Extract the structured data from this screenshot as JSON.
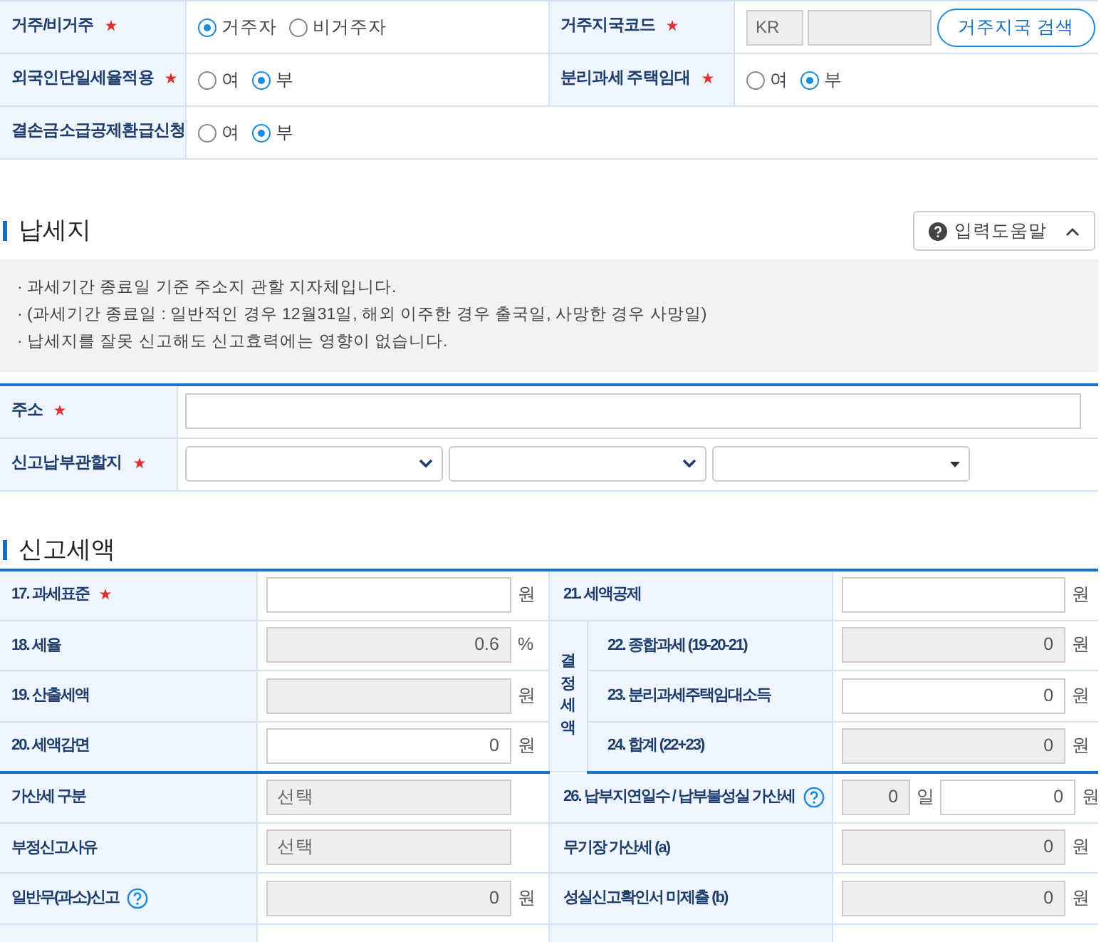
{
  "top_form": [
    {
      "label": "거주/비거주",
      "required": true,
      "kind": "radio",
      "options": [
        {
          "label": "거주자",
          "selected": true
        },
        {
          "label": "비거주자",
          "selected": false
        }
      ]
    },
    {
      "label": "거주지국코드",
      "required": true,
      "kind": "code",
      "code": "KR",
      "button": "거주지국 검색"
    },
    {
      "label": "외국인단일세율적용",
      "required": true,
      "kind": "radio",
      "options": [
        {
          "label": "여",
          "selected": false
        },
        {
          "label": "부",
          "selected": true
        }
      ]
    },
    {
      "label": "분리과세 주택임대",
      "required": true,
      "kind": "radio",
      "options": [
        {
          "label": "여",
          "selected": false
        },
        {
          "label": "부",
          "selected": true
        }
      ]
    },
    {
      "label": "결손금소급공제환급신청",
      "required": false,
      "kind": "radio",
      "options": [
        {
          "label": "여",
          "selected": false
        },
        {
          "label": "부",
          "selected": true
        }
      ]
    }
  ],
  "address_section": {
    "title": "납세지",
    "help_button": {
      "label": "입력도움말",
      "expanded": true
    },
    "notes": [
      "· 과세기간 종료일 기준 주소지 관할 지자체입니다.",
      "· (과세기간 종료일 : 일반적인 경우 12월31일, 해외 이주한 경우 출국일, 사망한 경우 사망일)",
      "· 납세지를 잘못 신고해도 신고효력에는 영향이 없습니다."
    ],
    "fields": [
      {
        "label": "주소",
        "required": true,
        "kind": "text"
      },
      {
        "label": "신고납부관할지",
        "required": true,
        "kind": "selects",
        "selects": [
          {
            "kind": "chevron"
          },
          {
            "kind": "chevron"
          },
          {
            "kind": "triangle"
          }
        ]
      }
    ]
  },
  "tax_section": {
    "title": "신고세액",
    "blocks": [
      {
        "left": [
          {
            "label": "17. 과세표준",
            "required": true,
            "inputs": [
              {
                "kind": "amount",
                "readonly": false,
                "unit": "원"
              }
            ]
          },
          {
            "label": "18. 세율",
            "inputs": [
              {
                "kind": "amount",
                "readonly": true,
                "value": "0.6",
                "unit": "%"
              }
            ]
          },
          {
            "label": "19. 산출세액",
            "inputs": [
              {
                "kind": "amount",
                "readonly": true,
                "unit": "원"
              }
            ]
          },
          {
            "label": "20. 세액감면",
            "inputs": [
              {
                "kind": "amount",
                "readonly": false,
                "value": "0",
                "unit": "원"
              }
            ]
          }
        ],
        "right": [
          {
            "label": "21. 세액공제",
            "inputs": [
              {
                "kind": "amount",
                "readonly": false,
                "unit": "원"
              }
            ]
          },
          {
            "group": "결정세액",
            "items": [
              {
                "label": "22. 종합과세 (19-20-21)",
                "inputs": [
                  {
                    "kind": "amount",
                    "readonly": true,
                    "value": "0",
                    "unit": "원"
                  }
                ]
              },
              {
                "label": "23. 분리과세주택임대소득",
                "inputs": [
                  {
                    "kind": "amount",
                    "readonly": false,
                    "value": "0",
                    "unit": "원"
                  }
                ]
              },
              {
                "label": "24. 합계 (22+23)",
                "inputs": [
                  {
                    "kind": "amount",
                    "readonly": true,
                    "value": "0",
                    "unit": "원"
                  }
                ]
              }
            ]
          }
        ]
      },
      {
        "left": [
          {
            "label": "가산세 구분",
            "inputs": [
              {
                "kind": "select",
                "readonly": true,
                "value": "선택"
              }
            ]
          },
          {
            "label": "부정신고사유",
            "inputs": [
              {
                "kind": "select",
                "readonly": true,
                "value": "선택"
              }
            ]
          },
          {
            "label": "일반무(과소)신고",
            "help": true,
            "inputs": [
              {
                "kind": "amount",
                "readonly": true,
                "value": "0",
                "unit": "원"
              }
            ]
          }
        ],
        "right": [
          {
            "label": "26. 납부지연일수 / 납부불성실 가산세",
            "help": true,
            "inputs": [
              {
                "kind": "days",
                "readonly": true,
                "value": "0",
                "unit": "일"
              },
              {
                "kind": "amount",
                "readonly": false,
                "value": "0",
                "unit": "원"
              }
            ]
          },
          {
            "label": "무기장 가산세 (a)",
            "inputs": [
              {
                "kind": "amount",
                "readonly": true,
                "value": "0",
                "unit": "원"
              }
            ]
          },
          {
            "label": "성실신고확인서 미제출 (b)",
            "inputs": [
              {
                "kind": "amount",
                "readonly": true,
                "value": "0",
                "unit": "원"
              }
            ]
          }
        ]
      }
    ]
  }
}
